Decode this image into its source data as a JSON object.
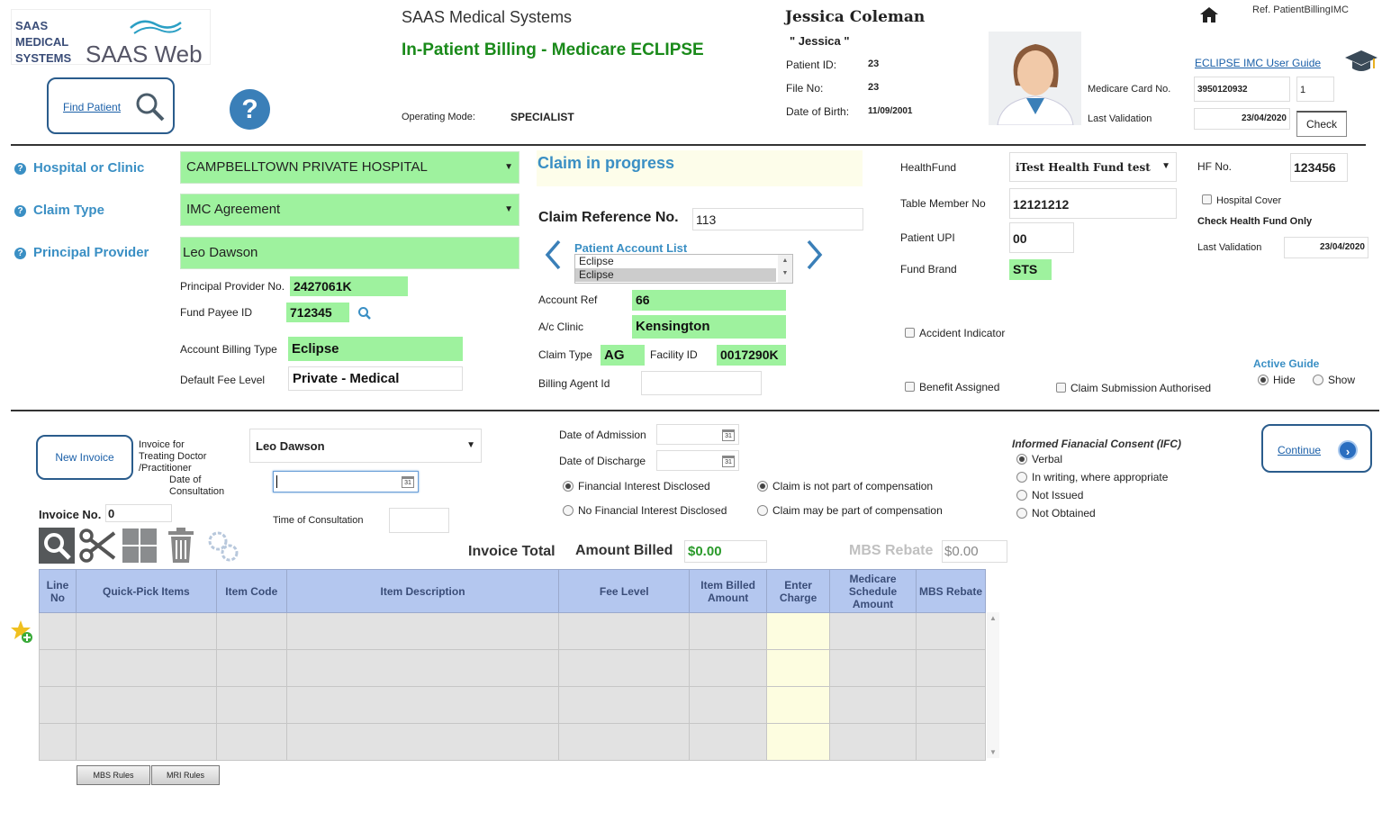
{
  "header": {
    "logo_text_line1": "SAAS",
    "logo_text_line2": "MEDICAL",
    "logo_text_line3": "SYSTEMS",
    "logo_brand": "SAAS Web",
    "company": "SAAS Medical Systems",
    "page_title": "In-Patient Billing - Medicare ECLIPSE",
    "find_patient": "Find Patient",
    "operating_mode_label": "Operating Mode:",
    "operating_mode_value": "SPECIALIST",
    "ref": "Ref. PatientBillingIMC",
    "user_guide": "ECLIPSE IMC User Guide"
  },
  "patient": {
    "name": "Jessica Coleman",
    "nickname": "\" Jessica \"",
    "patient_id_label": "Patient ID:",
    "patient_id": "23",
    "file_no_label": "File No:",
    "file_no": "23",
    "dob_label": "Date of Birth:",
    "dob": "11/09/2001",
    "medicare_label": "Medicare Card No.",
    "medicare_no": "3950120932",
    "medicare_irn": "1",
    "last_validation_label": "Last Validation",
    "last_validation": "23/04/2020",
    "check_button": "Check"
  },
  "claim": {
    "hospital_label": "Hospital or Clinic",
    "hospital_value": "CAMPBELLTOWN PRIVATE HOSPITAL",
    "claim_type_label": "Claim Type",
    "claim_type_value": "IMC Agreement",
    "principal_provider_label": "Principal Provider",
    "principal_provider_value": "Leo Dawson",
    "principal_provider_no_label": "Principal Provider No.",
    "principal_provider_no": "2427061K",
    "fund_payee_label": "Fund Payee ID",
    "fund_payee": "712345",
    "account_billing_type_label": "Account Billing Type",
    "account_billing_type": "Eclipse",
    "default_fee_label": "Default Fee Level",
    "default_fee": "Private - Medical",
    "status": "Claim in progress",
    "claim_ref_label": "Claim Reference No.",
    "claim_ref": "113",
    "patient_account_list_label": "Patient Account List",
    "account_list": [
      "Eclipse",
      "Eclipse"
    ],
    "account_ref_label": "Account Ref",
    "account_ref": "66",
    "ac_clinic_label": "A/c Clinic",
    "ac_clinic": "Kensington",
    "claim_type2_label": "Claim Type",
    "claim_type2": "AG",
    "facility_label": "Facility ID",
    "facility": "0017290K",
    "billing_agent_label": "Billing Agent Id"
  },
  "fund": {
    "healthfund_label": "HealthFund",
    "healthfund": "iTest Health Fund test",
    "hf_no_label": "HF No.",
    "hf_no": "123456",
    "table_member_label": "Table Member No",
    "table_member": "12121212",
    "hospital_cover": "Hospital Cover",
    "check_hf_only": "Check Health Fund Only",
    "patient_upi_label": "Patient UPI",
    "patient_upi": "00",
    "last_validation_label": "Last Validation",
    "last_validation": "23/04/2020",
    "fund_brand_label": "Fund Brand",
    "fund_brand": "STS",
    "accident_indicator": "Accident Indicator",
    "active_guide": "Active Guide",
    "hide": "Hide",
    "show": "Show",
    "benefit_assigned": "Benefit Assigned",
    "claim_submission": "Claim Submission Authorised"
  },
  "invoice": {
    "new_invoice": "New Invoice",
    "invoice_for_label": "Invoice for\nTreating Doctor\n/Practitioner",
    "doctor": "Leo Dawson",
    "date_consult_label": "Date of\nConsultation",
    "invoice_no_label": "Invoice No.",
    "invoice_no": "0",
    "time_consult_label": "Time of Consultation",
    "date_admission_label": "Date of Admission",
    "date_discharge_label": "Date of Discharge",
    "fin_disclosed": "Financial Interest Disclosed",
    "no_fin_disclosed": "No Financial Interest Disclosed",
    "not_compensation": "Claim is not part of compensation",
    "may_compensation": "Claim may be part of compensation",
    "ifc_label": "Informed Fianacial Consent (IFC)",
    "ifc_options": [
      "Verbal",
      "In writing, where appropriate",
      "Not Issued",
      "Not Obtained"
    ],
    "continue": "Continue",
    "invoice_total_label": "Invoice Total",
    "amount_billed_label": "Amount Billed",
    "amount_billed": "$0.00",
    "mbs_rebate_label": "MBS Rebate",
    "mbs_rebate": "$0.00",
    "columns": [
      "Line No",
      "Quick-Pick Items",
      "Item Code",
      "Item Description",
      "Fee Level",
      "Item Billed Amount",
      "Enter Charge",
      "Medicare Schedule Amount",
      "MBS Rebate"
    ],
    "mbs_rules": "MBS Rules",
    "mri_rules": "MRI Rules"
  },
  "colors": {
    "accent": "#3a8fc4",
    "green_field": "#9ef29e",
    "title_green": "#1a8a1a",
    "grid_header": "#b4c7ef"
  }
}
